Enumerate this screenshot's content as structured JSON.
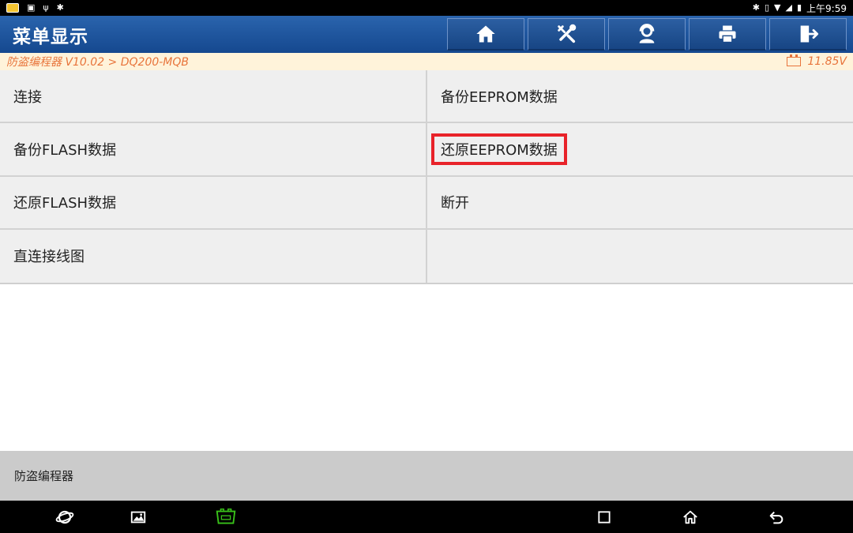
{
  "status": {
    "time": "上午9:59"
  },
  "header": {
    "title": "菜单显示"
  },
  "breadcrumb": {
    "path": "防盗编程器 V10.02 > DQ200-MQB",
    "voltage": "11.85V"
  },
  "menu": {
    "items": [
      {
        "label": "连接",
        "highlighted": false
      },
      {
        "label": "备份EEPROM数据",
        "highlighted": false
      },
      {
        "label": "备份FLASH数据",
        "highlighted": false
      },
      {
        "label": "还原EEPROM数据",
        "highlighted": true
      },
      {
        "label": "还原FLASH数据",
        "highlighted": false
      },
      {
        "label": "断开",
        "highlighted": false
      },
      {
        "label": "直连接线图",
        "highlighted": false
      },
      {
        "label": "",
        "highlighted": false
      }
    ]
  },
  "footer": {
    "label": "防盗编程器"
  },
  "colors": {
    "header": "#1f57a0",
    "breadcrumb_text": "#e8743b",
    "highlight": "#e8232a",
    "vci": "#39c21a"
  }
}
